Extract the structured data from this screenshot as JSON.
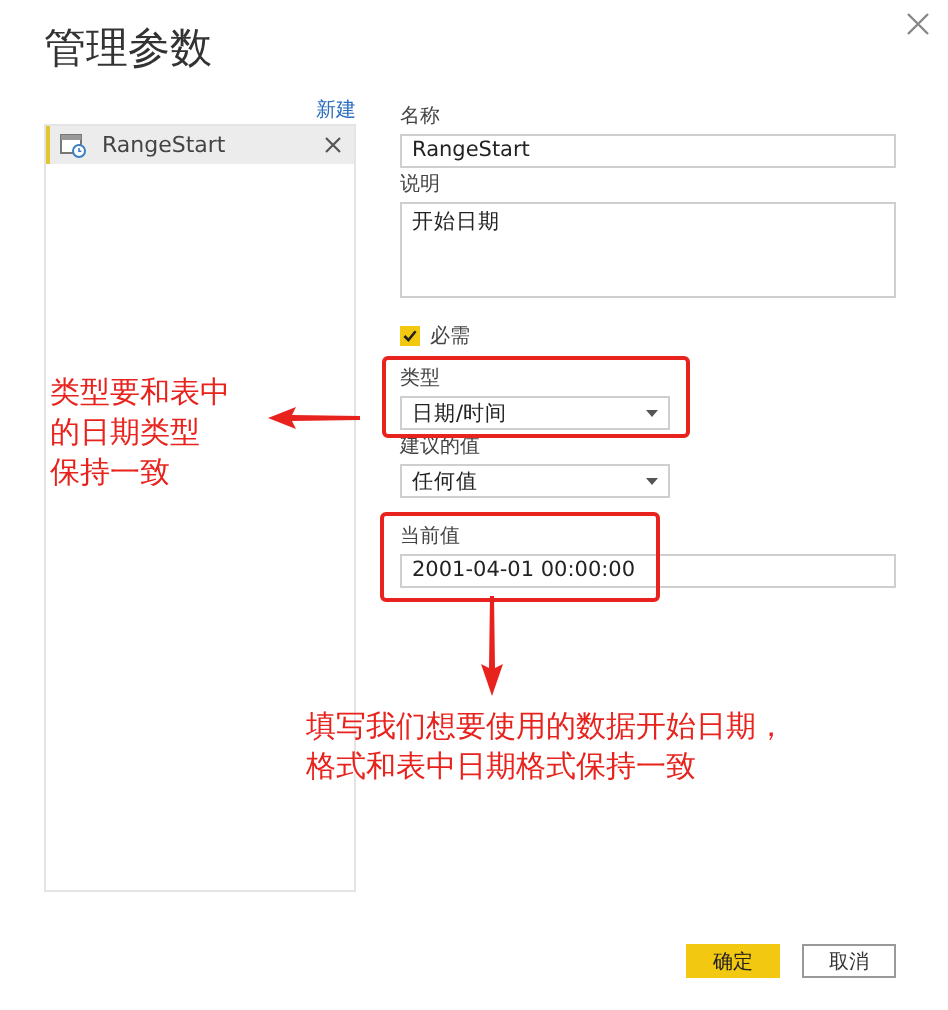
{
  "window": {
    "title": "管理参数"
  },
  "parameter_list": {
    "new_link": "新建",
    "items": [
      {
        "name": "RangeStart",
        "selected": true
      }
    ]
  },
  "form": {
    "name": {
      "label": "名称",
      "value": "RangeStart"
    },
    "description": {
      "label": "说明",
      "value": "开始日期"
    },
    "required": {
      "label": "必需",
      "checked": true
    },
    "type": {
      "label": "类型",
      "value": "日期/时间"
    },
    "suggested_values": {
      "label": "建议的值",
      "value": "任何值"
    },
    "current_value": {
      "label": "当前值",
      "value": "2001-04-01 00:00:00"
    }
  },
  "annotations": [
    {
      "lines": [
        "类型要和表中",
        "的日期类型",
        "保持一致"
      ]
    },
    {
      "lines": [
        "填写我们想要使用的数据开始日期，",
        "格式和表中日期格式保持一致"
      ]
    }
  ],
  "buttons": [
    {
      "label": "确定",
      "kind": "primary"
    },
    {
      "label": "取消",
      "kind": "secondary"
    }
  ]
}
